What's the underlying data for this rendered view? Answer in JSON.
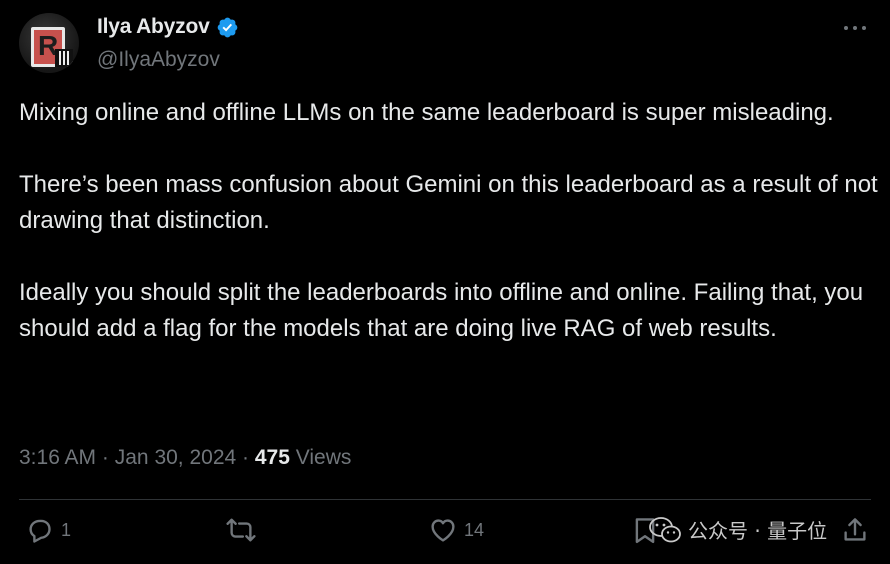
{
  "author": {
    "display_name": "Ilya Abyzov",
    "handle": "@IlyaAbyzov",
    "avatar_letter": "R",
    "verified": true
  },
  "tweet": {
    "paragraphs": [
      "Mixing online and offline LLMs on the same leaderboard is super misleading.",
      "There’s been mass confusion about Gemini on this leaderboard as a result of not drawing that distinction.",
      "Ideally you should split the leaderboards into offline and online. Failing that, you should add a flag for the models that are doing live RAG of web results."
    ],
    "time": "3:16 AM",
    "date": "Jan 30, 2024",
    "views_count": "475",
    "views_label": "Views",
    "separator": "·"
  },
  "actions": {
    "reply_count": "1",
    "like_count": "14"
  },
  "watermark": {
    "text": "公众号 · 量子位"
  },
  "icons": {
    "verified": "verified-badge-icon",
    "more": "more-icon",
    "reply": "reply-icon",
    "retweet": "retweet-icon",
    "like": "heart-icon",
    "bookmark": "bookmark-icon",
    "wechat": "wechat-icon"
  },
  "colors": {
    "background": "#000000",
    "text": "#e7e9ea",
    "muted": "#71767b",
    "verified": "#1d9bf0",
    "divider": "#2f3336"
  }
}
